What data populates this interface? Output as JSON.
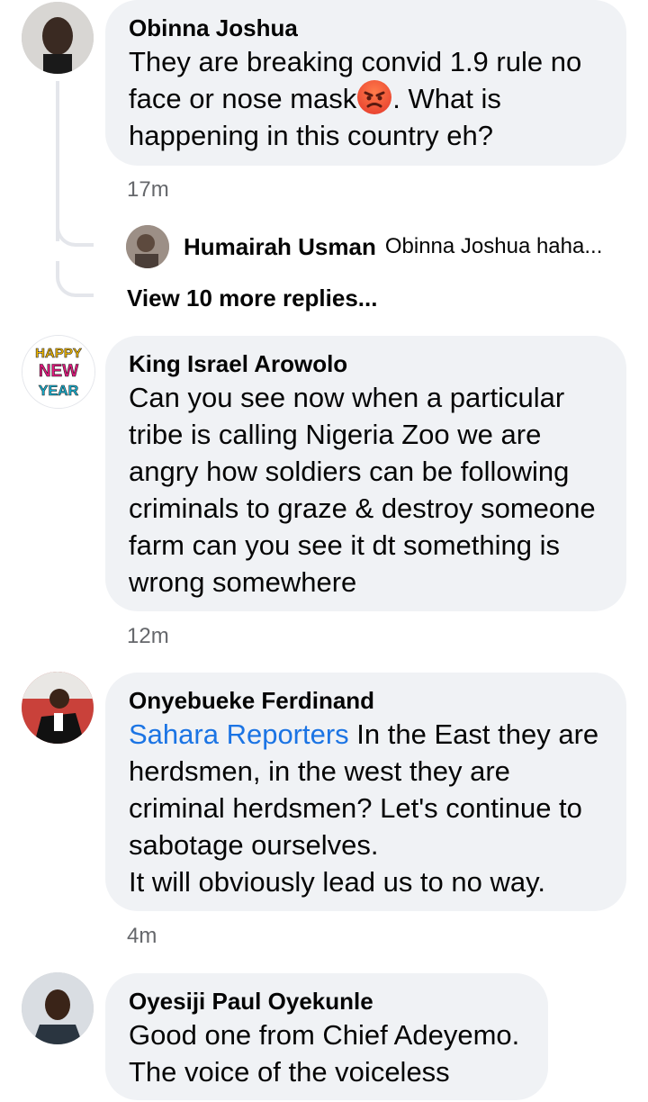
{
  "comments": [
    {
      "author": "Obinna Joshua",
      "text_before_emoji": "They are breaking convid 1.9 rule no face or nose mask",
      "emoji": "angry-face-emoji",
      "text_after_emoji": ". What is happening in this country eh?",
      "time": "17m",
      "replies": [
        {
          "author": "Humairah Usman",
          "snippet": "Obinna Joshua haha..."
        }
      ],
      "view_more": "View 10 more replies..."
    },
    {
      "author": "King Israel Arowolo",
      "avatar_text": [
        "HAPPY",
        "NEW",
        "YEAR"
      ],
      "text": "Can you see now when a particular tribe is calling Nigeria Zoo we are angry how soldiers can be following criminals to graze & destroy someone farm can you see it dt something is wrong somewhere",
      "time": "12m"
    },
    {
      "author": "Onyebueke Ferdinand",
      "mention": "Sahara Reporters",
      "text": " In the East they are herdsmen, in the west they are criminal herdsmen? Let's continue to sabotage ourselves.\nIt will obviously lead us to no way.",
      "time": "4m"
    },
    {
      "author": "Oyesiji Paul Oyekunle",
      "text": "Good one from Chief Adeyemo. The voice of the voiceless"
    }
  ],
  "colors": {
    "bubble": "#f0f2f5",
    "mention": "#1b74e4",
    "time": "#65676b",
    "thread_line": "#e4e6eb"
  }
}
